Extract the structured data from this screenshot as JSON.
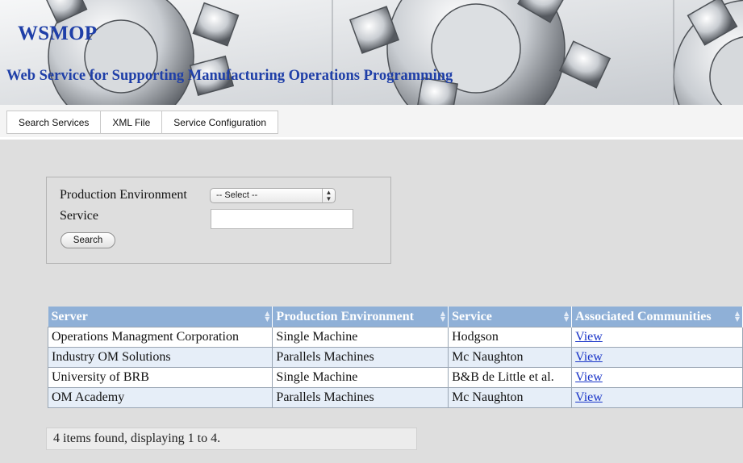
{
  "header": {
    "title": "WSMOP",
    "subtitle": "Web Service for Supporting Manufacturing Operations Programming"
  },
  "tabs": [
    {
      "label": "Search Services"
    },
    {
      "label": "XML File"
    },
    {
      "label": "Service Configuration"
    }
  ],
  "search": {
    "env_label": "Production Environment",
    "env_selected": "-- Select --",
    "service_label": "Service",
    "service_value": "",
    "button_label": "Search"
  },
  "table": {
    "columns": [
      "Server",
      "Production Environment",
      "Service",
      "Associated Communities"
    ],
    "rows": [
      {
        "server": "Operations Managment Corporation",
        "env": "Single Machine",
        "service": "Hodgson",
        "link": "View"
      },
      {
        "server": "Industry OM Solutions",
        "env": "Parallels Machines",
        "service": "Mc Naughton",
        "link": "View"
      },
      {
        "server": "University of BRB",
        "env": "Single Machine",
        "service": "B&B de Little et al.",
        "link": "View"
      },
      {
        "server": "OM Academy",
        "env": "Parallels Machines",
        "service": "Mc Naughton",
        "link": "View"
      }
    ]
  },
  "status": "4 items found, displaying 1 to 4.",
  "colors": {
    "title_blue": "#1f3fa8",
    "header_row": "#8fb0d7",
    "page_bg": "#dedede",
    "link": "#1a35c8"
  },
  "icons": {
    "sort": "sort-updown-icon",
    "select": "select-arrows-icon"
  }
}
